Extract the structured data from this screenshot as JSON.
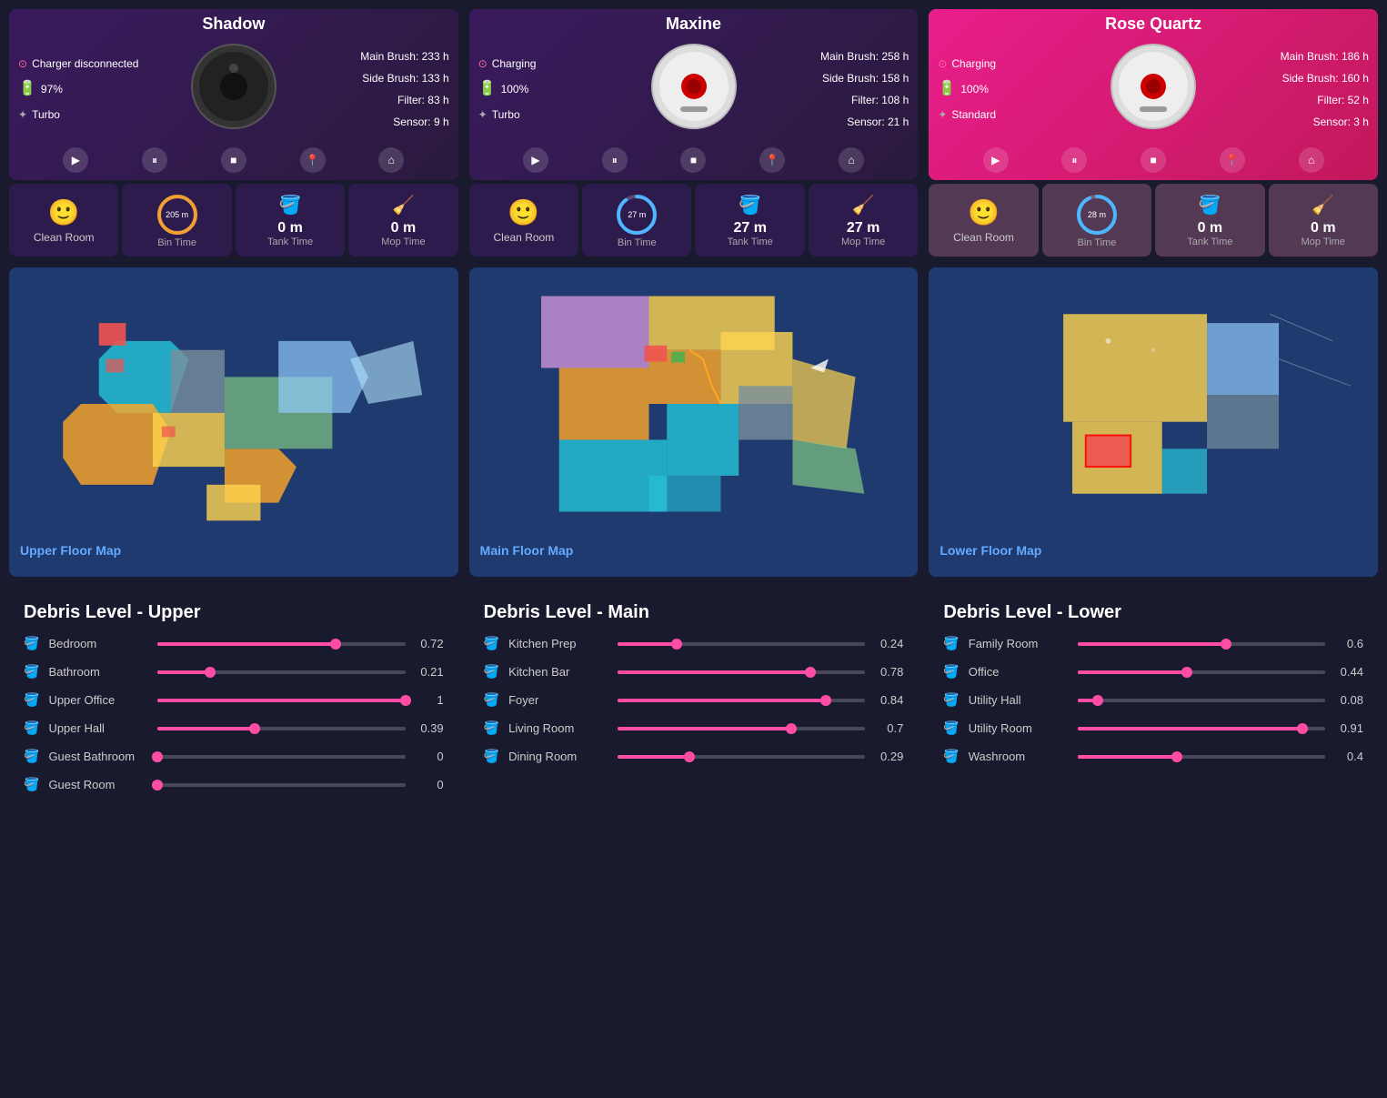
{
  "robots": [
    {
      "id": "shadow",
      "name": "Shadow",
      "theme": "dark",
      "status": "Charger disconnected",
      "battery": "97%",
      "speed": "Turbo",
      "brush_main": "Main Brush: 233 h",
      "brush_side": "Side Brush: 133 h",
      "filter": "Filter: 83 h",
      "sensor": "Sensor: 9 h",
      "robot_color": "dark",
      "clean_room_label": "Clean Room",
      "bin_time": "205 m",
      "bin_label": "Bin Time",
      "tank_time": "0 m",
      "tank_label": "Tank Time",
      "mop_time": "0 m",
      "mop_label": "Mop Time",
      "map_label": "Upper Floor Map"
    },
    {
      "id": "maxine",
      "name": "Maxine",
      "theme": "dark",
      "status": "Charging",
      "battery": "100%",
      "speed": "Turbo",
      "brush_main": "Main Brush: 258 h",
      "brush_side": "Side Brush: 158 h",
      "filter": "Filter: 108 h",
      "sensor": "Sensor: 21 h",
      "robot_color": "white",
      "clean_room_label": "Clean Room",
      "bin_time": "27 m",
      "bin_label": "Bin Time",
      "tank_time": "27 m",
      "tank_label": "Tank Time",
      "mop_time": "27 m",
      "mop_label": "Mop Time",
      "map_label": "Main Floor Map"
    },
    {
      "id": "rose_quartz",
      "name": "Rose Quartz",
      "theme": "pink",
      "status": "Charging",
      "battery": "100%",
      "speed": "Standard",
      "brush_main": "Main Brush: 186 h",
      "brush_side": "Side Brush: 160 h",
      "filter": "Filter: 52 h",
      "sensor": "Sensor: 3 h",
      "robot_color": "white",
      "clean_room_label": "Clean Room",
      "bin_time": "28 m",
      "bin_label": "Bin Time",
      "tank_time": "0 m",
      "tank_label": "Tank Time",
      "mop_time": "0 m",
      "mop_label": "Mop Time",
      "map_label": "Lower Floor Map"
    }
  ],
  "debris_sections": [
    {
      "title": "Debris Level - Upper",
      "rooms": [
        {
          "name": "Bedroom",
          "value": 0.72
        },
        {
          "name": "Bathroom",
          "value": 0.21
        },
        {
          "name": "Upper Office",
          "value": 1.0
        },
        {
          "name": "Upper Hall",
          "value": 0.39
        },
        {
          "name": "Guest Bathroom",
          "value": 0.0
        },
        {
          "name": "Guest Room",
          "value": 0.0
        }
      ]
    },
    {
      "title": "Debris Level - Main",
      "rooms": [
        {
          "name": "Kitchen Prep",
          "value": 0.24
        },
        {
          "name": "Kitchen Bar",
          "value": 0.78
        },
        {
          "name": "Foyer",
          "value": 0.84
        },
        {
          "name": "Living Room",
          "value": 0.7
        },
        {
          "name": "Dining Room",
          "value": 0.29
        }
      ]
    },
    {
      "title": "Debris Level - Lower",
      "rooms": [
        {
          "name": "Family Room",
          "value": 0.6
        },
        {
          "name": "Office",
          "value": 0.44
        },
        {
          "name": "Utility Hall",
          "value": 0.08
        },
        {
          "name": "Utility Room",
          "value": 0.91
        },
        {
          "name": "Washroom",
          "value": 0.4
        }
      ]
    }
  ],
  "controls": {
    "play": "▶",
    "pause": "⏸",
    "stop": "■",
    "locate": "📍",
    "home": "⌂"
  }
}
